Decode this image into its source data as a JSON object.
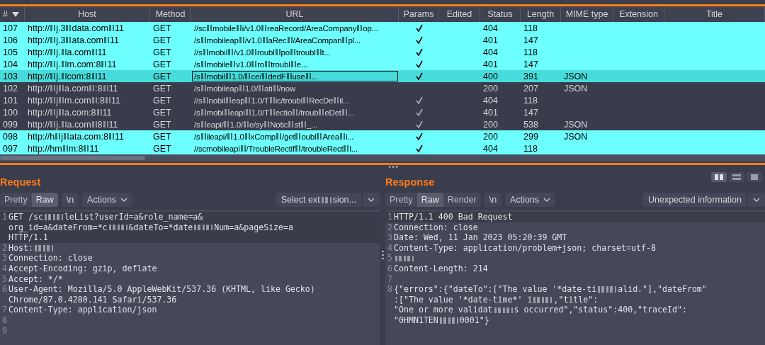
{
  "table": {
    "columns": [
      "#",
      "Host",
      "Method",
      "URL",
      "Params",
      "Edited",
      "Status",
      "Length",
      "MIME type",
      "Extension",
      "Title"
    ],
    "rows": [
      {
        "id": "107",
        "host": [
          "http://",
          "j.3",
          "data.com",
          "11"
        ],
        "method": "GET",
        "url": [
          "//sc",
          "mobile",
          "i/v1.0",
          "reaRecord/AreaCompany",
          "op..."
        ],
        "params": true,
        "status": "404",
        "length": "118",
        "mime": "",
        "highlighted": true,
        "selected": false
      },
      {
        "id": "106",
        "host": [
          "http://",
          "j.3",
          "ata.com",
          "11"
        ],
        "method": "GET",
        "url": [
          "/s",
          "mobileap",
          "/v1.0",
          "aRec",
          "/AreaCompan",
          "pl..."
        ],
        "params": true,
        "status": "401",
        "length": "147",
        "mime": "",
        "highlighted": true,
        "selected": false
      },
      {
        "id": "105",
        "host": [
          "http://",
          "j.",
          "a.com",
          "11"
        ],
        "method": "GET",
        "url": [
          "//s",
          "mobil",
          "/v1.0",
          "roubl",
          "po",
          "troubl",
          "t..."
        ],
        "params": true,
        "status": "404",
        "length": "118",
        "mime": "",
        "highlighted": true,
        "selected": false
      },
      {
        "id": "104",
        "host": [
          "http://",
          "j.",
          "m.com:8",
          "11"
        ],
        "method": "GET",
        "url": [
          "/s",
          "mobile",
          "v1.0",
          "ro",
          "troubl",
          "e..."
        ],
        "params": true,
        "status": "401",
        "length": "147",
        "mime": "",
        "highlighted": true,
        "selected": false
      },
      {
        "id": "103",
        "host": [
          "http://",
          "j.",
          "com:8",
          "11"
        ],
        "method": "GET",
        "url": [
          "/s",
          "mobil",
          "1.0/",
          "ce/",
          "dedF",
          "use",
          "..."
        ],
        "params": true,
        "status": "400",
        "length": "391",
        "mime": "JSON",
        "highlighted": true,
        "selected": true
      },
      {
        "id": "102",
        "host": [
          "http://",
          "j",
          "a.com",
          ":8",
          "11"
        ],
        "method": "GET",
        "url": [
          "/s",
          "mobileap",
          "1.0/",
          "ati",
          "/now"
        ],
        "params": false,
        "status": "200",
        "length": "207",
        "mime": "JSON",
        "highlighted": false,
        "selected": false
      },
      {
        "id": "101",
        "host": [
          "http://",
          "j",
          "m.com",
          ":8",
          "11"
        ],
        "method": "GET",
        "url": [
          "//s",
          "nobil",
          "eap",
          "1.0/T",
          "ic/troubl",
          "RecDe",
          "il..."
        ],
        "params": true,
        "status": "404",
        "length": "118",
        "mime": "",
        "highlighted": false,
        "selected": false
      },
      {
        "id": "100",
        "host": [
          "http://",
          "j",
          "a.com:8",
          "11"
        ],
        "method": "GET",
        "url": [
          "/s",
          "mobi",
          "eapi",
          "1.0/T",
          "ectio",
          "/troub",
          "eDet",
          "..."
        ],
        "params": true,
        "status": "401",
        "length": "147",
        "mime": "",
        "highlighted": false,
        "selected": false
      },
      {
        "id": "099",
        "host": [
          "http://",
          "j.",
          "a.com",
          "8",
          "11"
        ],
        "method": "GET",
        "url": [
          "/s",
          "eapi/",
          "1.0/",
          "e/sy",
          "Notic",
          "st",
          "_..."
        ],
        "params": true,
        "status": "200",
        "length": "538",
        "mime": "JSON",
        "highlighted": false,
        "selected": false
      },
      {
        "id": "098",
        "host": [
          "http://h",
          "j",
          "ata.com:8",
          "11"
        ],
        "method": "GET",
        "url": [
          "/s",
          "ileapi/",
          "1.0",
          "xComp",
          "/get",
          "oubl",
          "Area",
          "i..."
        ],
        "params": true,
        "status": "200",
        "length": "299",
        "mime": "JSON",
        "highlighted": true,
        "selected": false
      },
      {
        "id": "097",
        "host": [
          "http://hm",
          "m:8",
          "11"
        ],
        "method": "GET",
        "url": [
          "//scmobileapi",
          "/TroubleRectif",
          "/troubleRect",
          "l..."
        ],
        "params": true,
        "status": "404",
        "length": "118",
        "mime": "",
        "highlighted": true,
        "selected": false
      }
    ]
  },
  "request": {
    "title": "Request",
    "tabs": [
      {
        "label": "Pretty",
        "selected": false
      },
      {
        "label": "Raw",
        "selected": true
      }
    ],
    "newline": "\\n",
    "actions": "Actions",
    "dropdown": [
      "Select ext",
      "sion..."
    ],
    "lines": [
      {
        "number": "1",
        "wrapped": [
          {
            "parts": [
              "GET /sc",
              {
                "kind": "redacted"
              },
              "leList?userId=a&role_name=a&"
            ]
          },
          {
            "parts": [
              "org_id=a&dateFrom=*c",
              {
                "kind": "redacted"
              },
              "&dateTo=*date",
              {
                "kind": "redacted"
              },
              "Num=a&pageSize=a"
            ]
          },
          {
            "parts": [
              "HTTP/1.1"
            ]
          }
        ]
      },
      {
        "number": "2",
        "wrapped": [
          {
            "parts": [
              "Host:",
              {
                "kind": "redacted"
              }
            ]
          }
        ]
      },
      {
        "number": "3",
        "wrapped": [
          {
            "parts": [
              "Connection: close"
            ]
          }
        ]
      },
      {
        "number": "4",
        "wrapped": [
          {
            "parts": [
              "Accept-Encoding: gzip, deflate"
            ]
          }
        ]
      },
      {
        "number": "5",
        "wrapped": [
          {
            "parts": [
              "Accept: */*"
            ]
          }
        ]
      },
      {
        "number": "6",
        "wrapped": [
          {
            "parts": [
              "User-Agent: Mozilla/5.0 AppleWebKit/537.36 (KHTML, like Gecko)"
            ]
          },
          {
            "parts": [
              "Chrome/87.0.4280.141 Safari/537.36"
            ]
          }
        ]
      },
      {
        "number": "7",
        "wrapped": [
          {
            "parts": [
              "Content-Type: application/json"
            ]
          }
        ]
      },
      {
        "number": "8"
      },
      {
        "number": "9"
      }
    ]
  },
  "response": {
    "title": "Response",
    "tabs": [
      {
        "label": "Pretty",
        "selected": false
      },
      {
        "label": "Raw",
        "selected": true
      },
      {
        "label": "Render",
        "selected": false
      }
    ],
    "newline": "\\n",
    "actions": "Actions",
    "dropdown": [
      "Unexpected information"
    ],
    "lines": [
      {
        "number": "1",
        "wrapped": [
          {
            "parts": [
              "HTTP/1.1 400 Bad Request"
            ]
          }
        ]
      },
      {
        "number": "2",
        "wrapped": [
          {
            "parts": [
              "Connection: close"
            ]
          }
        ]
      },
      {
        "number": "3",
        "wrapped": [
          {
            "parts": [
              "Date: Wed, 11 Jan 2023 05:20:39 GMT"
            ]
          }
        ]
      },
      {
        "number": "4",
        "wrapped": [
          {
            "parts": [
              "Content-Type: application/problem+json; charset=utf-8"
            ]
          }
        ]
      },
      {
        "number": "5",
        "wrapped": [
          {
            "parts": [
              {
                "kind": "redacted"
              }
            ]
          }
        ]
      },
      {
        "number": "6",
        "wrapped": [
          {
            "parts": [
              "Content-Length: 214"
            ]
          }
        ]
      },
      {
        "number": "7"
      },
      {
        "number": "8",
        "wrapped": [
          {
            "parts": [
              "{\"errors\":{\"dateTo\":[\"The value '*date-ti",
              {
                "kind": "redacted"
              },
              "alid.\"],\"dateFrom\""
            ]
          },
          {
            "parts": [
              ":[\"The value '*date-time*' i",
              {
                "kind": "redacted"
              },
              ",\"title\":"
            ]
          },
          {
            "parts": [
              "\"One or more validat",
              {
                "kind": "redacted"
              },
              "s occurred\",\"status\":400,\"traceId\":"
            ]
          },
          {
            "parts": [
              "\"0HMN1TEN",
              {
                "kind": "redacted"
              },
              "0001\"}"
            ]
          }
        ]
      }
    ]
  }
}
